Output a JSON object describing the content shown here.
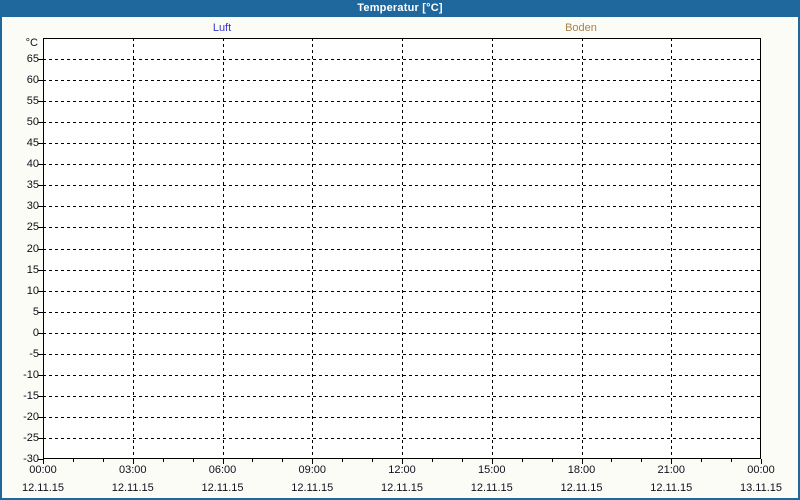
{
  "window": {
    "title": "Temperatur [°C]"
  },
  "colors": {
    "titlebar": "#1e689d",
    "frame_border": "#1e689d",
    "background": "#fbfcf5",
    "plot_background": "#ffffff",
    "grid": "#000000",
    "axis_text": "#10101e",
    "luft": "#3535cf",
    "boden": "#a9814c"
  },
  "chart_data": {
    "type": "line",
    "title": "Temperatur [°C]",
    "xlabel": "",
    "ylabel": "°C",
    "ylim": [
      -30,
      70
    ],
    "ytick_step": 5,
    "yticks": [
      65,
      60,
      55,
      50,
      45,
      40,
      35,
      30,
      25,
      20,
      15,
      10,
      5,
      0,
      -5,
      -10,
      -15,
      -20,
      -25,
      -30
    ],
    "x_axis": {
      "tick_times": [
        "00:00",
        "03:00",
        "06:00",
        "09:00",
        "12:00",
        "15:00",
        "18:00",
        "21:00",
        "00:00"
      ],
      "tick_dates": [
        "12.11.15",
        "12.11.15",
        "12.11.15",
        "12.11.15",
        "12.11.15",
        "12.11.15",
        "12.11.15",
        "12.11.15",
        "13.11.15"
      ],
      "minor_ticks_per_major": 3
    },
    "series": [
      {
        "name": "Luft",
        "color": "#3535cf",
        "values": []
      },
      {
        "name": "Boden",
        "color": "#a9814c",
        "values": []
      }
    ],
    "grid": {
      "horizontal": "dashed",
      "vertical": "dashed",
      "on": true
    },
    "legend_position": "top"
  }
}
